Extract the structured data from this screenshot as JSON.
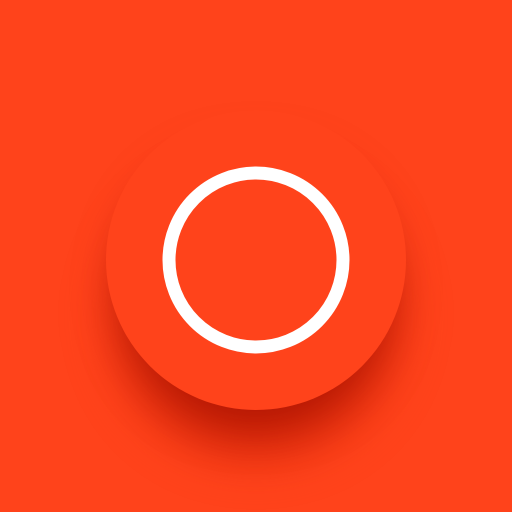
{
  "app_icon": {
    "background_color": "#FF431B",
    "disc_color": "#FF431B",
    "shadow_color": "#B01400",
    "ring_color": "#FFFFFF",
    "center_icon": "ring-icon"
  }
}
